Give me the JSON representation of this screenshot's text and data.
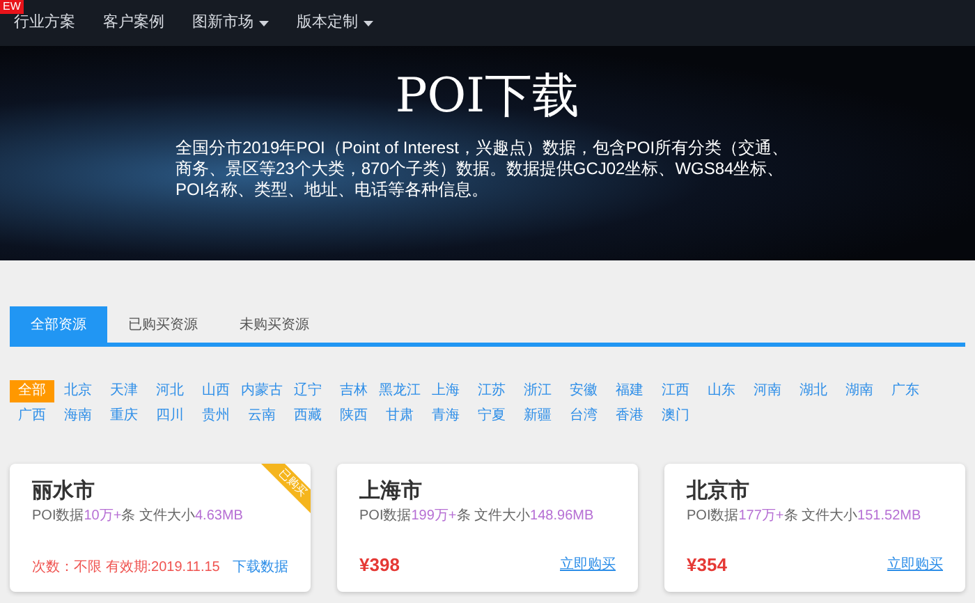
{
  "nav": {
    "badge": "EW",
    "items": [
      {
        "label": "行业方案",
        "dropdown": false
      },
      {
        "label": "客户案例",
        "dropdown": false
      },
      {
        "label": "图新市场",
        "dropdown": true
      },
      {
        "label": "版本定制",
        "dropdown": true
      }
    ]
  },
  "hero": {
    "title": "POI下载",
    "description": "全国分市2019年POI（Point of Interest，兴趣点）数据，包含POI所有分类（交通、商务、景区等23个大类，870个子类）数据。数据提供GCJ02坐标、WGS84坐标、POI名称、类型、地址、电话等各种信息。"
  },
  "tabs": [
    {
      "label": "全部资源",
      "selected": true
    },
    {
      "label": "已购买资源",
      "selected": false
    },
    {
      "label": "未购买资源",
      "selected": false
    }
  ],
  "regions": [
    {
      "label": "全部",
      "selected": true
    },
    {
      "label": "北京",
      "selected": false
    },
    {
      "label": "天津",
      "selected": false
    },
    {
      "label": "河北",
      "selected": false
    },
    {
      "label": "山西",
      "selected": false
    },
    {
      "label": "内蒙古",
      "selected": false
    },
    {
      "label": "辽宁",
      "selected": false
    },
    {
      "label": "吉林",
      "selected": false
    },
    {
      "label": "黑龙江",
      "selected": false
    },
    {
      "label": "上海",
      "selected": false
    },
    {
      "label": "江苏",
      "selected": false
    },
    {
      "label": "浙江",
      "selected": false
    },
    {
      "label": "安徽",
      "selected": false
    },
    {
      "label": "福建",
      "selected": false
    },
    {
      "label": "江西",
      "selected": false
    },
    {
      "label": "山东",
      "selected": false
    },
    {
      "label": "河南",
      "selected": false
    },
    {
      "label": "湖北",
      "selected": false
    },
    {
      "label": "湖南",
      "selected": false
    },
    {
      "label": "广东",
      "selected": false
    },
    {
      "label": "广西",
      "selected": false
    },
    {
      "label": "海南",
      "selected": false
    },
    {
      "label": "重庆",
      "selected": false
    },
    {
      "label": "四川",
      "selected": false
    },
    {
      "label": "贵州",
      "selected": false
    },
    {
      "label": "云南",
      "selected": false
    },
    {
      "label": "西藏",
      "selected": false
    },
    {
      "label": "陕西",
      "selected": false
    },
    {
      "label": "甘肃",
      "selected": false
    },
    {
      "label": "青海",
      "selected": false
    },
    {
      "label": "宁夏",
      "selected": false
    },
    {
      "label": "新疆",
      "selected": false
    },
    {
      "label": "台湾",
      "selected": false
    },
    {
      "label": "香港",
      "selected": false
    },
    {
      "label": "澳门",
      "selected": false
    }
  ],
  "cards": [
    {
      "kind": "purchased",
      "city": "丽水市",
      "ribbon": "已购买",
      "stats_prefix": "POI数据",
      "count": "10万+",
      "stats_middle": "条 文件大小",
      "size": "4.63MB",
      "validity": "次数：不限 有效期:2019.11.15",
      "action": "下载数据"
    },
    {
      "kind": "for_sale",
      "city": "上海市",
      "stats_prefix": "POI数据",
      "count": "199万+",
      "stats_middle": "条 文件大小",
      "size": "148.96MB",
      "price": "¥398",
      "action": "立即购买"
    },
    {
      "kind": "for_sale",
      "city": "北京市",
      "stats_prefix": "POI数据",
      "count": "177万+",
      "stats_middle": "条 文件大小",
      "size": "151.52MB",
      "price": "¥354",
      "action": "立即购买"
    }
  ]
}
